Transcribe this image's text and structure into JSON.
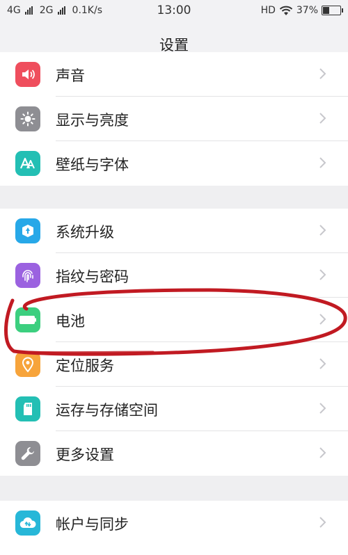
{
  "status_bar": {
    "sim1": "4G",
    "sim2": "2G",
    "speed": "0.1K/s",
    "time": "13:00",
    "hd": "HD",
    "battery": "37%"
  },
  "header": {
    "title": "设置"
  },
  "colors": {
    "sound": "#ef4e5d",
    "display": "#8e8e93",
    "wallpaper": "#23bfb4",
    "update": "#27a8e8",
    "fingerprint": "#9b62e0",
    "battery": "#3ccf7f",
    "location": "#f7a43b",
    "storage": "#23bfb4",
    "more": "#8e8e93",
    "account": "#27b7d8",
    "annotation": "#c11a22"
  },
  "groups": [
    {
      "rows": [
        {
          "label": "声音",
          "icon": "speaker-icon"
        },
        {
          "label": "显示与亮度",
          "icon": "sun-icon"
        },
        {
          "label": "壁纸与字体",
          "icon": "font-icon"
        }
      ]
    },
    {
      "rows": [
        {
          "label": "系统升级",
          "icon": "update-icon"
        },
        {
          "label": "指纹与密码",
          "icon": "fingerprint-icon"
        },
        {
          "label": "电池",
          "icon": "battery-icon"
        },
        {
          "label": "定位服务",
          "icon": "location-pin-icon"
        },
        {
          "label": "运存与存储空间",
          "icon": "sd-card-icon"
        },
        {
          "label": "更多设置",
          "icon": "wrench-icon"
        }
      ]
    },
    {
      "rows": [
        {
          "label": "帐户与同步",
          "icon": "cloud-sync-icon"
        }
      ]
    }
  ]
}
